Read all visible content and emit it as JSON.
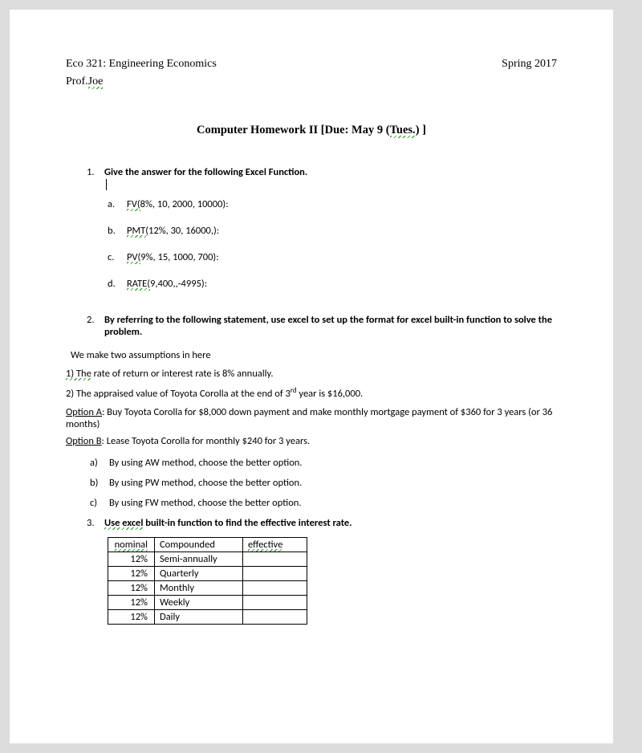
{
  "header": {
    "course": "Eco 321: Engineering Economics",
    "term": "Spring 2017",
    "prof_prefix": "Prof.",
    "prof_squiggle": "Joe"
  },
  "title": {
    "prefix": "Computer Homework II  [Due: May 9 (",
    "squiggle": "Tues.",
    "suffix": ") ]"
  },
  "q1": {
    "num": "1.",
    "prompt": "Give the answer for the following Excel Function.",
    "items": [
      {
        "letter": "a.",
        "fn_sq": "FV(",
        "rest": "8%, 10, 2000, 10000):"
      },
      {
        "letter": "b.",
        "fn_sq": "PMT(",
        "rest": "12%, 30, 16000,):"
      },
      {
        "letter": "c.",
        "fn_sq": "PV(",
        "rest": "9%, 15, 1000, 700):"
      },
      {
        "letter": "d.",
        "fn_sq": "RATE(",
        "rest": "9,400,,-4995):"
      }
    ]
  },
  "q2": {
    "num": "2.",
    "prompt": "By referring to the following statement, use excel to set up the format for excel built-in function to solve the problem.",
    "assump_intro": "We make two assumptions in here",
    "line1_sq": "1) The",
    "line1_rest": " rate of return or interest rate is 8% annually.",
    "line2_prefix": "2) The appraised value of Toyota Corolla at the end of 3",
    "line2_sup": "rd",
    "line2_rest": " year is $16,000.",
    "optA_label": "Option A",
    "optA_text": ": Buy Toyota Corolla for $8,000 down payment and make monthly mortgage payment of $360 for 3 years (or 36 months)",
    "optB_label": "Option B",
    "optB_text": ": Lease Toyota Corolla for monthly $240 for 3 years.",
    "subs": [
      {
        "letter": "a)",
        "text": "By using AW method, choose the better option."
      },
      {
        "letter": "b)",
        "text": "By using PW method, choose the better option."
      },
      {
        "letter": "c)",
        "text": "By using FW method, choose the better option."
      }
    ]
  },
  "q3": {
    "num": "3.",
    "sq": "Use excel",
    "rest": " built-in function to find the effective interest rate.",
    "table": {
      "h_nom": "nominal",
      "h_comp": "Compounded",
      "h_eff": "effective",
      "rows": [
        {
          "nom": "12%",
          "comp": "Semi-annually",
          "eff": ""
        },
        {
          "nom": "12%",
          "comp": "Quarterly",
          "eff": ""
        },
        {
          "nom": "12%",
          "comp": "Monthly",
          "eff": ""
        },
        {
          "nom": "12%",
          "comp": "Weekly",
          "eff": ""
        },
        {
          "nom": "12%",
          "comp": "Daily",
          "eff": ""
        }
      ]
    }
  }
}
